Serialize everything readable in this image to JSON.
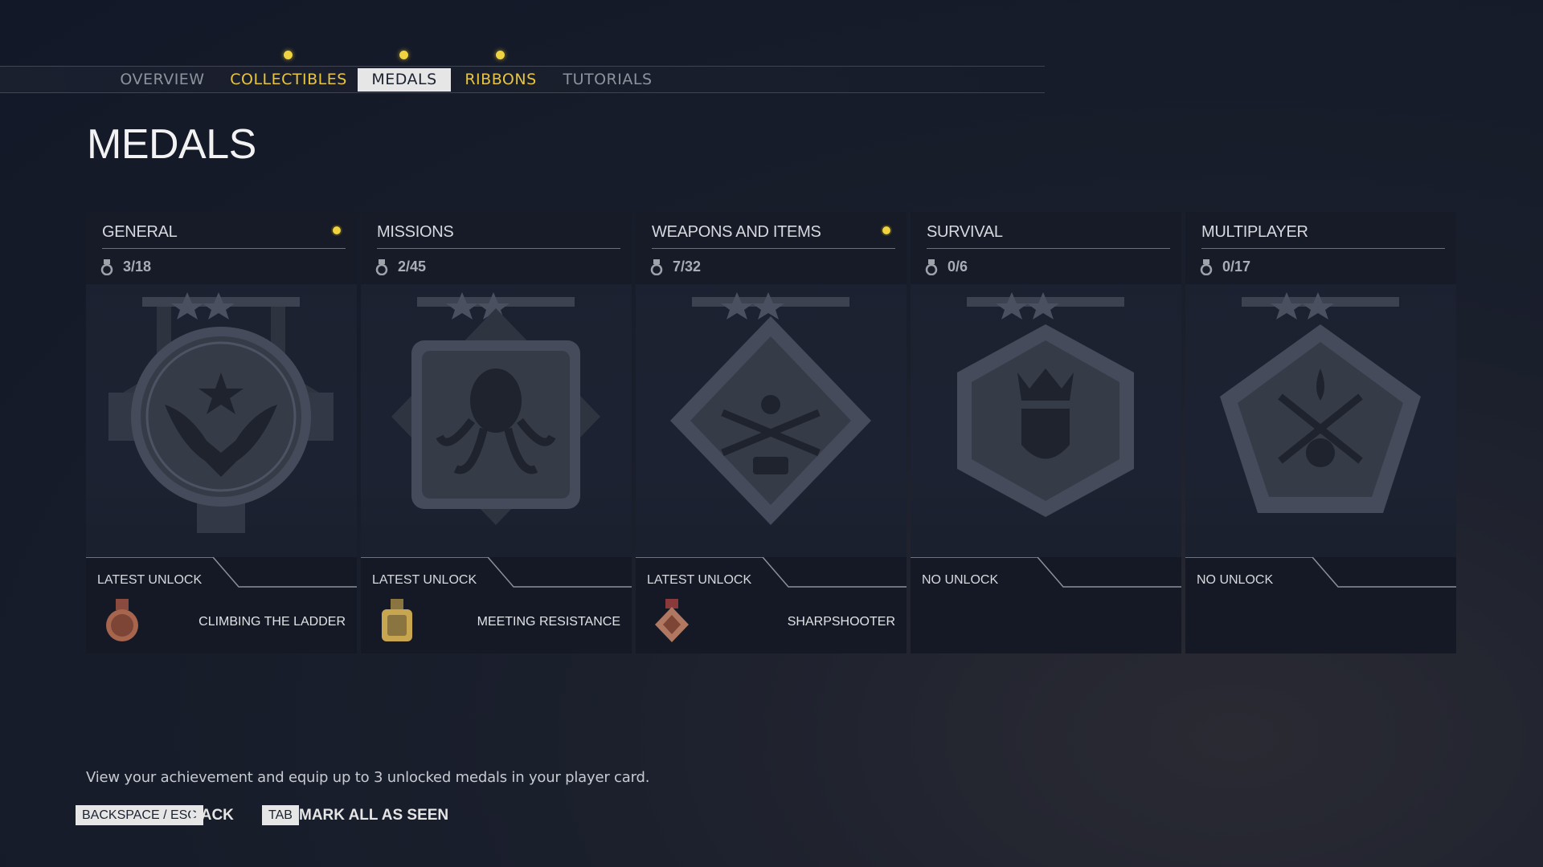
{
  "nav": {
    "tabs": [
      {
        "label": "OVERVIEW",
        "state": "plain",
        "dot": false
      },
      {
        "label": "COLLECTIBLES",
        "state": "gold",
        "dot": true
      },
      {
        "label": "MEDALS",
        "state": "active",
        "dot": true
      },
      {
        "label": "RIBBONS",
        "state": "gold",
        "dot": true
      },
      {
        "label": "TUTORIALS",
        "state": "plain",
        "dot": false
      }
    ]
  },
  "page": {
    "title": "MEDALS"
  },
  "cards": [
    {
      "title": "GENERAL",
      "count": "3/18",
      "new": true,
      "unlock_label": "LATEST UNLOCK",
      "unlock_name": "CLIMBING THE LADDER",
      "medal_icon": "eagle-medal-icon",
      "unlock_icon": "bronze-medal-icon"
    },
    {
      "title": "MISSIONS",
      "count": "2/45",
      "new": false,
      "unlock_label": "LATEST UNLOCK",
      "unlock_name": "MEETING RESISTANCE",
      "medal_icon": "octopus-medal-icon",
      "unlock_icon": "gold-medal-icon"
    },
    {
      "title": "WEAPONS AND ITEMS",
      "count": "7/32",
      "new": true,
      "unlock_label": "LATEST UNLOCK",
      "unlock_name": "SHARPSHOOTER",
      "medal_icon": "crossed-rifles-medal-icon",
      "unlock_icon": "bronze-diamond-medal-icon"
    },
    {
      "title": "SURVIVAL",
      "count": "0/6",
      "new": false,
      "unlock_label": "NO UNLOCK",
      "unlock_name": "",
      "medal_icon": "crown-shield-medal-icon",
      "unlock_icon": ""
    },
    {
      "title": "MULTIPLAYER",
      "count": "0/17",
      "new": false,
      "unlock_label": "NO UNLOCK",
      "unlock_name": "",
      "medal_icon": "skull-blades-medal-icon",
      "unlock_icon": ""
    }
  ],
  "footer": {
    "description": "View your achievement and equip up to 3 unlocked medals in your player card.",
    "back_key": "BACKSPACE / ESC",
    "back_label": "BACK",
    "mark_key": "TAB",
    "mark_label": "MARK ALL AS SEEN"
  },
  "colors": {
    "accent_gold": "#f0d340",
    "tab_gold": "#e8c53e",
    "active_tab_bg": "#e6e6e6"
  }
}
